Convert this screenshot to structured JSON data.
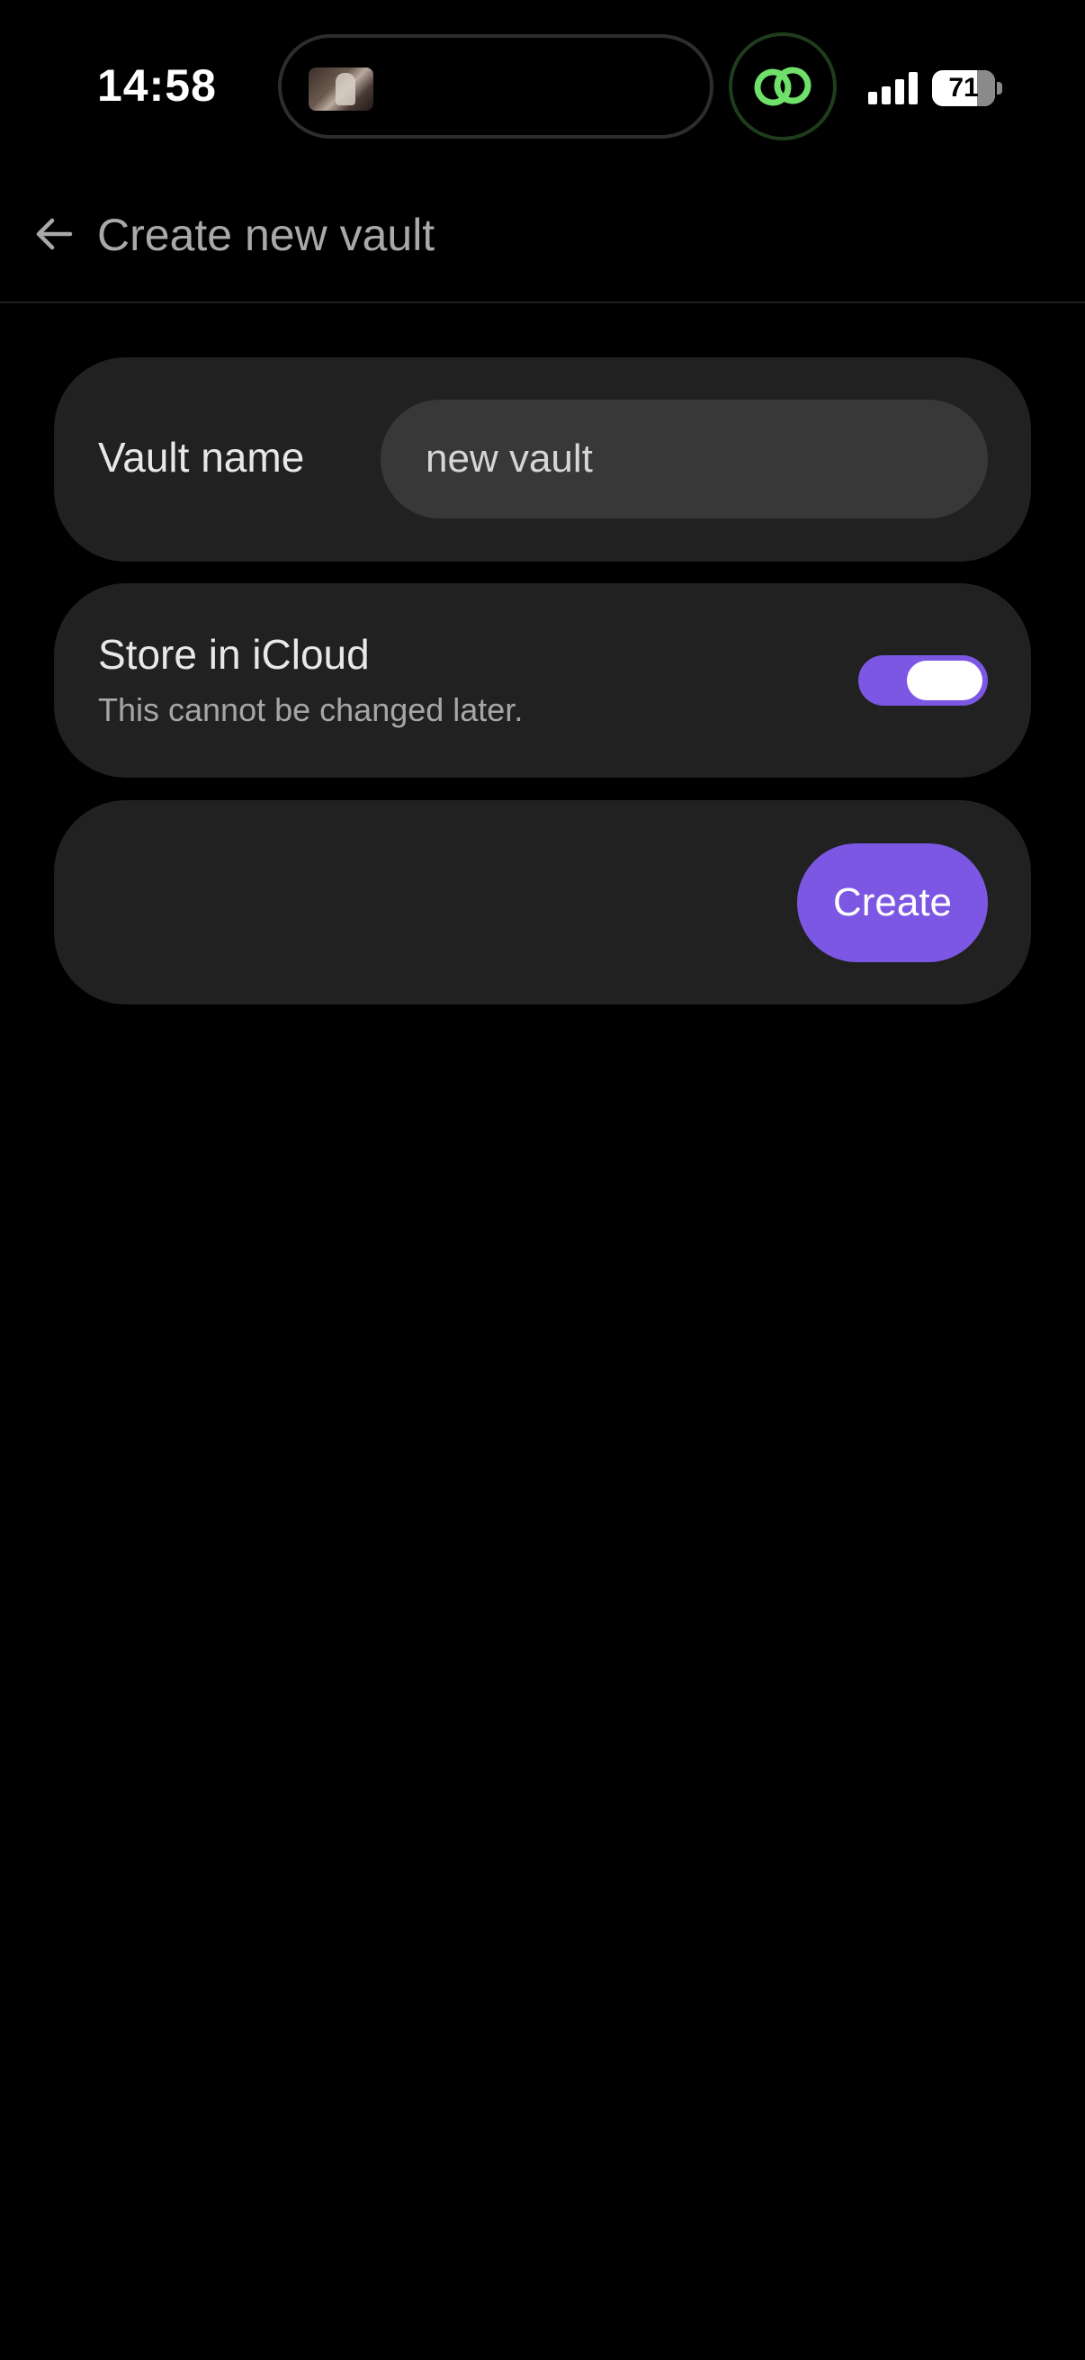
{
  "status_bar": {
    "time": "14:58",
    "battery_percent": "71",
    "battery_level": 0.71,
    "signal_bars": 4,
    "link_icon_color": "#6fe06a"
  },
  "header": {
    "title": "Create new vault",
    "back_icon": "arrow-left-icon"
  },
  "vault_name_card": {
    "label": "Vault name",
    "input_value": "new vault"
  },
  "icloud_card": {
    "label": "Store in iCloud",
    "subtitle": "This cannot be changed later.",
    "toggle_on": true
  },
  "create_card": {
    "button_label": "Create"
  },
  "colors": {
    "accent": "#7c57e3",
    "card_background": "#212121",
    "input_background": "#383838",
    "page_background": "#000000"
  }
}
